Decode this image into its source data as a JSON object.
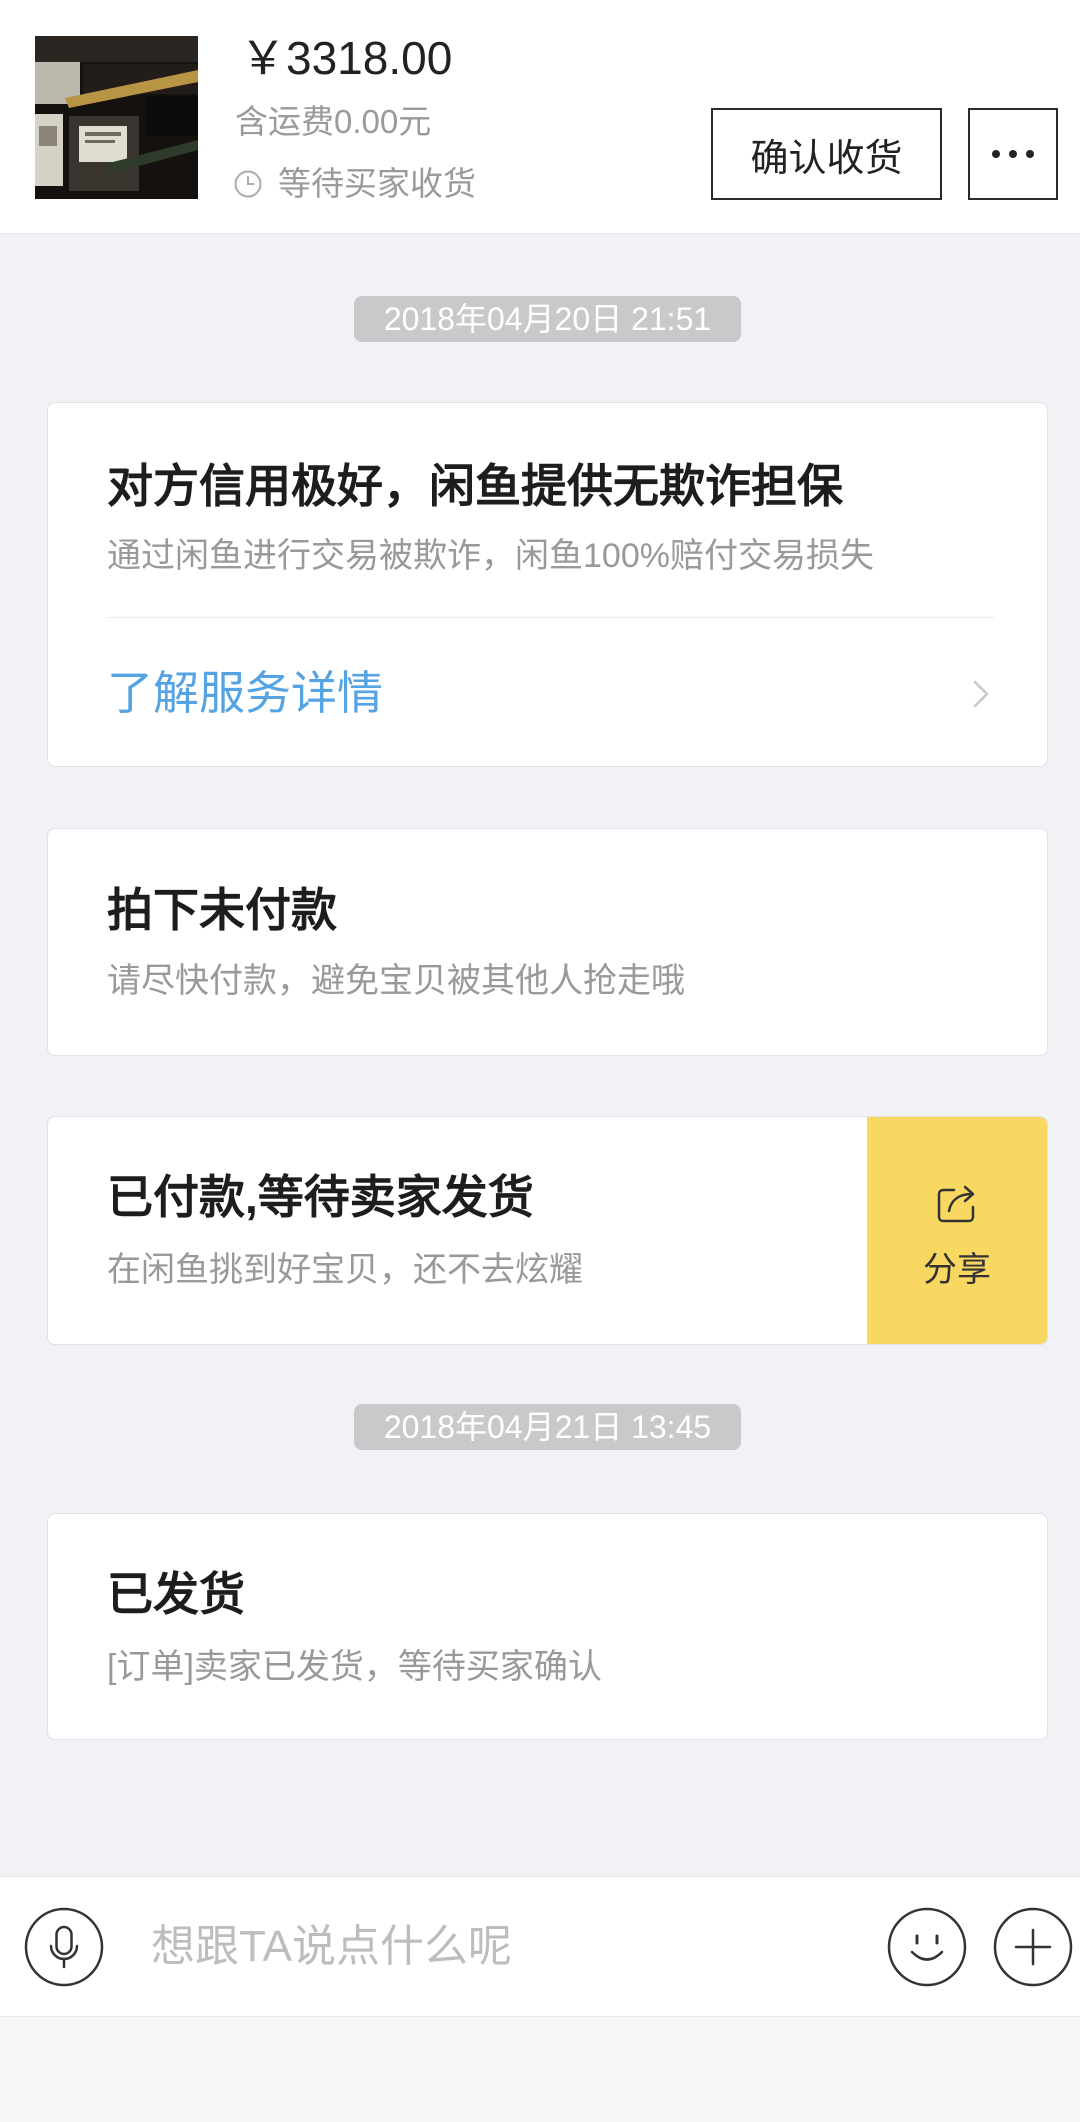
{
  "header": {
    "thumbnail_icon": "product-photo",
    "price": "￥3318.00",
    "shipping": "含运费0.00元",
    "status_icon": "clock-icon",
    "status": "等待买家收货",
    "confirm_button": "确认收货",
    "more_icon": "more-icon"
  },
  "timeline": {
    "timestamp_1": "2018年04月20日 21:51",
    "timestamp_2": "2018年04月21日 13:45"
  },
  "cards": [
    {
      "title": "对方信用极好，闲鱼提供无欺诈担保",
      "desc": "通过闲鱼进行交易被欺诈，闲鱼100%赔付交易损失",
      "link": "了解服务详情",
      "link_icon": "chevron-right-icon"
    },
    {
      "title": "拍下未付款",
      "desc": "请尽快付款，避免宝贝被其他人抢走哦"
    },
    {
      "title": "已付款,等待卖家发货",
      "desc": "在闲鱼挑到好宝贝，还不去炫耀",
      "share_label": "分享",
      "share_icon": "share-icon"
    },
    {
      "title": "已发货",
      "desc": "[订单]卖家已发货，等待买家确认"
    }
  ],
  "input_bar": {
    "placeholder": "想跟TA说点什么呢",
    "voice_icon": "microphone-icon",
    "emoji_icon": "smiley-icon",
    "add_icon": "plus-icon"
  },
  "colors": {
    "page_bg": "#f1f2f6",
    "link": "#55a3e3",
    "share_bg": "#f9d862",
    "badge_bg": "#c9c9cb"
  }
}
